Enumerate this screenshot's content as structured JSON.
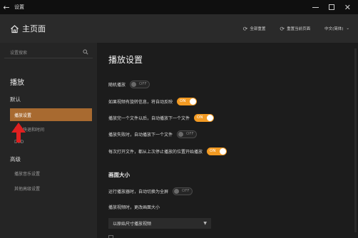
{
  "titlebar": {
    "title": "设置"
  },
  "header": {
    "title": "主页面",
    "buttons": [
      {
        "label": "全部重置",
        "icon": "reset-icon"
      },
      {
        "label": "重置当前页面",
        "icon": "reset-page-icon"
      }
    ],
    "language": "中文(简体)"
  },
  "sidebar": {
    "search_placeholder": "设置搜索",
    "section_title": "播放",
    "groups": [
      {
        "title": "默认",
        "items": [
          "播放设置",
          "快进快退和时间",
          "DVD"
        ],
        "active": "播放设置"
      },
      {
        "title": "高级",
        "items": [
          "播放音乐设置",
          "其他高级设置"
        ]
      }
    ]
  },
  "main": {
    "title": "播放设置",
    "settings": [
      {
        "label": "随机播放",
        "state": "OFF"
      },
      {
        "label": "如果视频有旋转信息，将自动反映",
        "state": "ON"
      },
      {
        "label": "播放完一个文件以后，自动播放下一个文件",
        "state": "ON"
      },
      {
        "label": "播放失败时，自动播放下一个文件",
        "state": "OFF"
      },
      {
        "label": "每次打开文件，都从上次停止播放的位置开始播放",
        "state": "ON"
      }
    ],
    "screen_section": {
      "title": "画面大小",
      "fullscreen": {
        "label": "运行播放器时，自动切换为全屏",
        "state": "OFF"
      },
      "resize_label": "播放视频时，更改画面大小",
      "resize_value": "以原始尺寸播放视频"
    }
  },
  "colors": {
    "accent": "#f29a23",
    "active_item": "#a86a30",
    "arrow": "#e02020"
  }
}
